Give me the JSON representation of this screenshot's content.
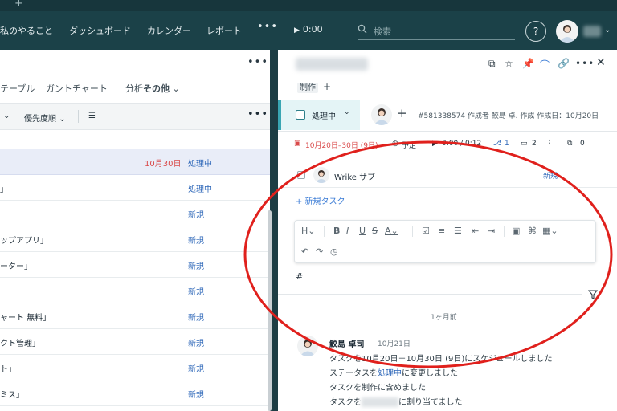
{
  "tabstrip": {
    "plus": "+"
  },
  "nav": {
    "items": [
      "私のやること",
      "ダッシュボード",
      "カレンダー",
      "レポート"
    ],
    "more": "•••",
    "timer": "0:00",
    "search_placeholder": "検索",
    "help": "?"
  },
  "left": {
    "menu": "•••",
    "tabs": [
      "テーブル",
      "ガントチャート"
    ],
    "tab_prefix": "分析",
    "tab_more": "その他",
    "toolbar": {
      "sort": "優先度順",
      "more": "•••"
    },
    "rows": [
      {
        "name": "",
        "date": "10月30日",
        "status": "処理中",
        "selected": true
      },
      {
        "name": "」",
        "date": "",
        "status": "処理中"
      },
      {
        "name": "",
        "date": "",
        "status": "新規"
      },
      {
        "name": "ップアプリ」",
        "date": "",
        "status": "新規"
      },
      {
        "name": "ーター」",
        "date": "",
        "status": "新規"
      },
      {
        "name": "",
        "date": "",
        "status": "新規"
      },
      {
        "name": "ャート 無料」",
        "date": "",
        "status": "新規"
      },
      {
        "name": "クト管理」",
        "date": "",
        "status": "新規"
      },
      {
        "name": "ト」",
        "date": "",
        "status": "新規"
      },
      {
        "name": "ミス」",
        "date": "",
        "status": "新規"
      }
    ]
  },
  "right": {
    "tag": "制作",
    "add": "+",
    "status": "処理中",
    "meta_text": "#581338574 作成者 鮫島 卓. 作成 作成日：10月20日",
    "meta_row": {
      "dates": "10月20日–30日 (9日)",
      "due": "予定",
      "time": "0:00 / 0:12",
      "subtasks": "1",
      "attachments": "2",
      "deps": "0"
    },
    "subtask": {
      "name": "Wrike サブ",
      "status": "新規"
    },
    "new_task": "+ 新規タスク",
    "editor_hash": "#",
    "ago": "1ヶ月前",
    "activity": {
      "user": "鮫島 卓司",
      "date": "10月21日",
      "line1": "タスクを10月20日－10月30日 (9日)にスケジュールしました",
      "line2_a": "ステータスを",
      "line2_link": "処理中",
      "line2_b": "に変更しました",
      "line3_a": "タスクを",
      "line3_link": "制作",
      "line3_b": "に含めました",
      "line4_a": "タスクを",
      "line4_b": "に割り当てました"
    }
  },
  "colors": {
    "accent_red": "#d94a4a",
    "link_blue": "#2c66b8",
    "annotation": "#e0201c",
    "topbar": "#1b4148"
  }
}
